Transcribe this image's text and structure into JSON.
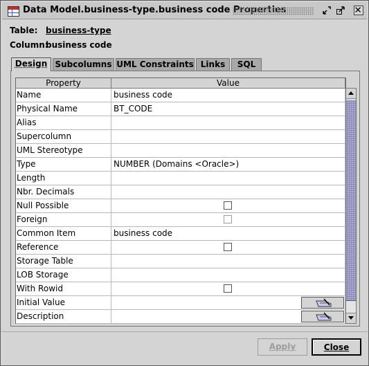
{
  "window": {
    "title": "Data Model.business-type.business code Properties"
  },
  "header": {
    "table_label": "Table:",
    "table_value": "business-type",
    "column_label": "Column:",
    "column_value": "business code"
  },
  "tabs": [
    {
      "label": "Design",
      "active": true
    },
    {
      "label": "Subcolumns",
      "active": false
    },
    {
      "label": "UML Constraints",
      "active": false
    },
    {
      "label": "Links",
      "active": false
    },
    {
      "label": "SQL",
      "active": false
    }
  ],
  "table": {
    "columns": [
      "Property",
      "Value"
    ],
    "rows": [
      {
        "property": "Name",
        "value": "business code",
        "kind": "text"
      },
      {
        "property": "Physical Name",
        "value": "BT_CODE",
        "kind": "text"
      },
      {
        "property": "Alias",
        "value": "",
        "kind": "text"
      },
      {
        "property": "Supercolumn",
        "value": "",
        "kind": "text"
      },
      {
        "property": "UML Stereotype",
        "value": "",
        "kind": "text"
      },
      {
        "property": "Type",
        "value": "NUMBER (Domains <Oracle>)",
        "kind": "text"
      },
      {
        "property": "Length",
        "value": "",
        "kind": "text"
      },
      {
        "property": "Nbr. Decimals",
        "value": "",
        "kind": "text"
      },
      {
        "property": "Null Possible",
        "value": "",
        "kind": "checkbox",
        "checked": false,
        "disabled": false
      },
      {
        "property": "Foreign",
        "value": "",
        "kind": "checkbox",
        "checked": false,
        "disabled": true
      },
      {
        "property": "Common Item",
        "value": "business code",
        "kind": "text"
      },
      {
        "property": "Reference",
        "value": "",
        "kind": "checkbox",
        "checked": false,
        "disabled": false
      },
      {
        "property": "Storage Table",
        "value": "",
        "kind": "text"
      },
      {
        "property": "LOB Storage",
        "value": "",
        "kind": "text"
      },
      {
        "property": "With Rowid",
        "value": "",
        "kind": "checkbox",
        "checked": false,
        "disabled": false
      },
      {
        "property": "Initial Value",
        "value": "",
        "kind": "editor"
      },
      {
        "property": "Description",
        "value": "",
        "kind": "editor"
      }
    ]
  },
  "buttons": {
    "apply": "Apply",
    "close": "Close"
  },
  "icons": {
    "title": "table-grid-icon",
    "minimize": "minimize-icon",
    "maximize": "maximize-icon",
    "close": "close-icon",
    "editor": "hand-pen-icon"
  }
}
